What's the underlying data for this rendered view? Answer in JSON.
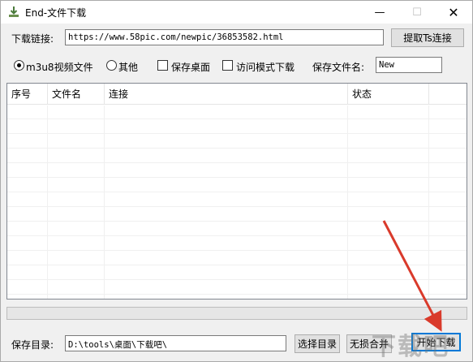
{
  "window": {
    "title": "End-文件下载",
    "controls": {
      "minimize": "—",
      "maximize": "☐",
      "close": "✕"
    }
  },
  "url_row": {
    "label": "下载链接:",
    "value": "https://www.58pic.com/newpic/36853582.html",
    "button": "提取Ts连接"
  },
  "options": {
    "radio_m3u8": {
      "label": "m3u8视频文件",
      "selected": true
    },
    "radio_other": {
      "label": "其他",
      "selected": false
    },
    "check_desktop": {
      "label": "保存桌面",
      "checked": false
    },
    "check_visit_mode": {
      "label": "访问模式下载",
      "checked": false
    },
    "filename_label": "保存文件名:",
    "filename_value": "New"
  },
  "table": {
    "columns": [
      "序号",
      "文件名",
      "连接",
      "状态"
    ],
    "rows": []
  },
  "progress": {
    "percent": 0
  },
  "bottom": {
    "dir_label": "保存目录:",
    "dir_value": "D:\\tools\\桌面\\下载吧\\",
    "choose_dir_button": "选择目录",
    "merge_button": "无损合并",
    "start_button": "开始下载"
  },
  "colors": {
    "arrow": "#d93a2b",
    "progress_fill": "#06b025"
  }
}
